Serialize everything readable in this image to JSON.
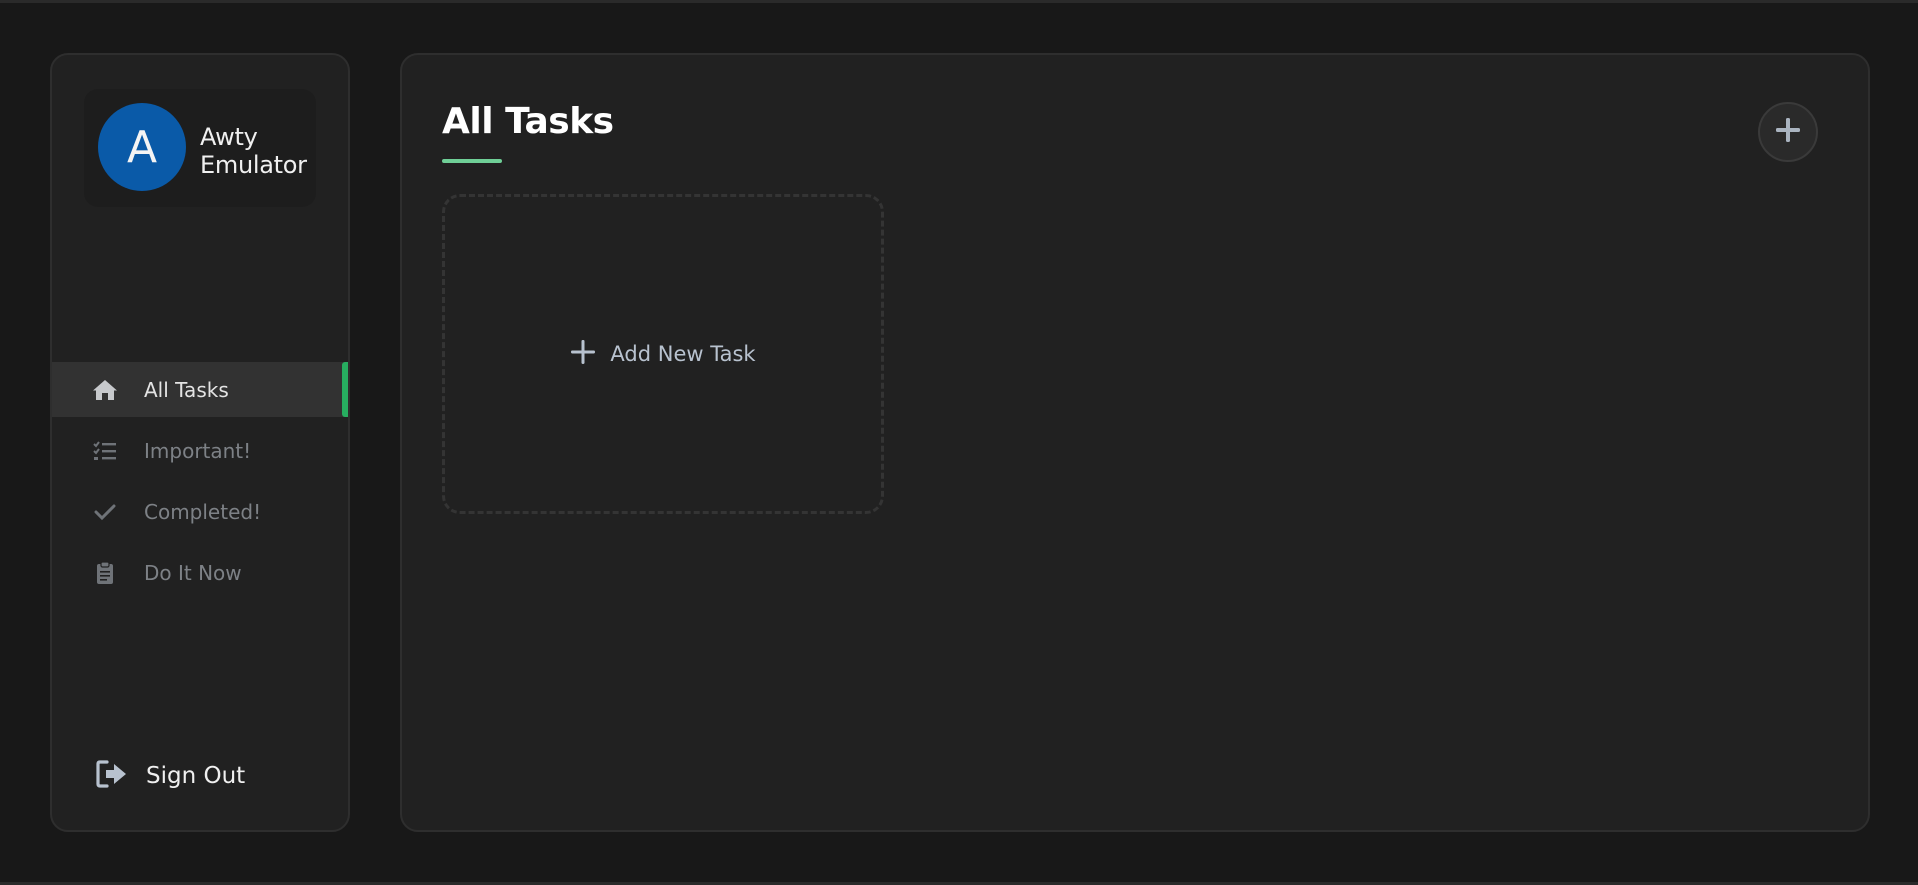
{
  "profile": {
    "avatar_initial": "A",
    "name_line1": "Awty",
    "name_line2": "Emulator"
  },
  "nav": {
    "items": [
      {
        "label": "All Tasks",
        "icon": "home-icon",
        "active": true
      },
      {
        "label": "Important!",
        "icon": "checklist-icon",
        "active": false
      },
      {
        "label": "Completed!",
        "icon": "check-icon",
        "active": false
      },
      {
        "label": "Do It Now",
        "icon": "clipboard-icon",
        "active": false
      }
    ]
  },
  "signout": {
    "label": "Sign Out",
    "icon": "sign-out-icon"
  },
  "main": {
    "title": "All Tasks",
    "add_button_icon": "plus-icon",
    "add_card_label": "Add New Task"
  },
  "colors": {
    "accent": "#27ae60",
    "title_underline": "#6fcf97",
    "avatar_bg": "#0a5aa8",
    "panel_bg": "#212121",
    "page_bg": "#181818"
  }
}
